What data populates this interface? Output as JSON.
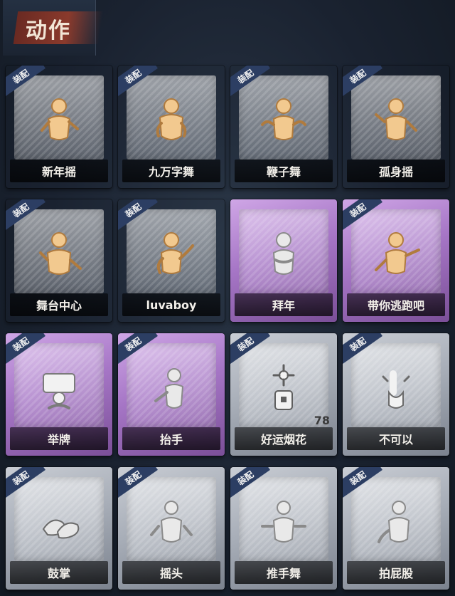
{
  "header": {
    "title": "动作"
  },
  "colors": {
    "gold": "#d8b23c",
    "purple": "#a676c6",
    "gray": "#a8aeb8",
    "equip_badge": "#2c3e63"
  },
  "cards": [
    {
      "label": "新年摇",
      "rarity": "gold",
      "equipped": true,
      "icon": "dance-figure-icon"
    },
    {
      "label": "九万字舞",
      "rarity": "gold",
      "equipped": true,
      "icon": "dance-figure-icon"
    },
    {
      "label": "鞭子舞",
      "rarity": "gold",
      "equipped": true,
      "icon": "dance-figure-icon"
    },
    {
      "label": "孤身摇",
      "rarity": "gold",
      "equipped": true,
      "icon": "dance-figure-icon"
    },
    {
      "label": "舞台中心",
      "rarity": "gold",
      "equipped": true,
      "icon": "dance-figure-icon"
    },
    {
      "label": "luvaboy",
      "rarity": "gold",
      "equipped": true,
      "icon": "dance-figure-icon"
    },
    {
      "label": "拜年",
      "rarity": "purple",
      "equipped": false,
      "icon": "bow-figure-icon"
    },
    {
      "label": "带你逃跑吧",
      "rarity": "purple",
      "equipped": true,
      "icon": "pointing-figure-icon"
    },
    {
      "label": "举牌",
      "rarity": "purple",
      "equipped": true,
      "icon": "hold-sign-icon"
    },
    {
      "label": "抬手",
      "rarity": "purple",
      "equipped": true,
      "icon": "raise-hand-figure-icon"
    },
    {
      "label": "好运烟花",
      "rarity": "gray",
      "equipped": true,
      "icon": "firework-icon",
      "count": "78"
    },
    {
      "label": "不可以",
      "rarity": "gray",
      "equipped": true,
      "icon": "finger-wag-icon"
    },
    {
      "label": "鼓掌",
      "rarity": "gray",
      "equipped": true,
      "icon": "clap-hands-icon"
    },
    {
      "label": "摇头",
      "rarity": "gray",
      "equipped": true,
      "icon": "shake-head-figure-icon"
    },
    {
      "label": "推手舞",
      "rarity": "gray",
      "equipped": true,
      "icon": "push-hands-figure-icon"
    },
    {
      "label": "拍屁股",
      "rarity": "gray",
      "equipped": true,
      "icon": "pat-figure-icon"
    }
  ],
  "equip_badge_text": "装配"
}
